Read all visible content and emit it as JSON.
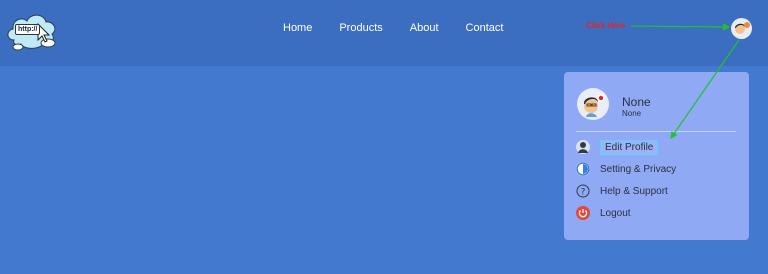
{
  "logo": {
    "text": "http://"
  },
  "nav": {
    "links": [
      {
        "label": "Home"
      },
      {
        "label": "Products"
      },
      {
        "label": "About"
      },
      {
        "label": "Contact"
      }
    ]
  },
  "annotation": {
    "text": "Click Here",
    "color": "#e8232a",
    "arrow_color": "#22c22a"
  },
  "profile": {
    "name": "None",
    "subtitle": "None"
  },
  "menu": {
    "items": [
      {
        "label": "Edit Profile",
        "icon": "user-icon"
      },
      {
        "label": "Setting & Privacy",
        "icon": "settings-icon"
      },
      {
        "label": "Help & Support",
        "icon": "help-icon"
      },
      {
        "label": "Logout",
        "icon": "power-icon"
      }
    ]
  },
  "colors": {
    "page_background": "#4479d0",
    "header_background": "#3b6ec0",
    "dropdown_background": "#8fa9f5",
    "highlight_border": "#54d4ff"
  }
}
